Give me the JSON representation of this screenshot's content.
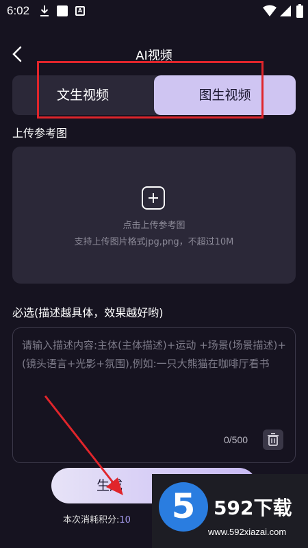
{
  "status_bar": {
    "time": "6:02",
    "badge": "A"
  },
  "header": {
    "title": "AI视频"
  },
  "tabs": [
    {
      "label": "文生视频",
      "selected": false
    },
    {
      "label": "图生视频",
      "selected": true
    }
  ],
  "upload": {
    "section_label": "上传参考图",
    "hint_line1": "点击上传参考图",
    "hint_line2": "支持上传图片格式jpg,png，不超过10M"
  },
  "prompt": {
    "section_label": "必选(描述越具体，效果越好哟)",
    "placeholder": "请输入描述内容:主体(主体描述)+运动 +场景(场景描述)+(镜头语言+光影+氛围),例如:一只大熊猫在咖啡厅看书",
    "char_count": "0/500"
  },
  "generate": {
    "label": "生成"
  },
  "points": {
    "label": "本次消耗积分:",
    "value": "10"
  },
  "watermark": {
    "digit": "5",
    "brand": "592下载",
    "url": "www.592xiazai.com"
  },
  "colors": {
    "background": "#161320",
    "accent": "#cfc5f2",
    "annotation": "#e0252b"
  }
}
